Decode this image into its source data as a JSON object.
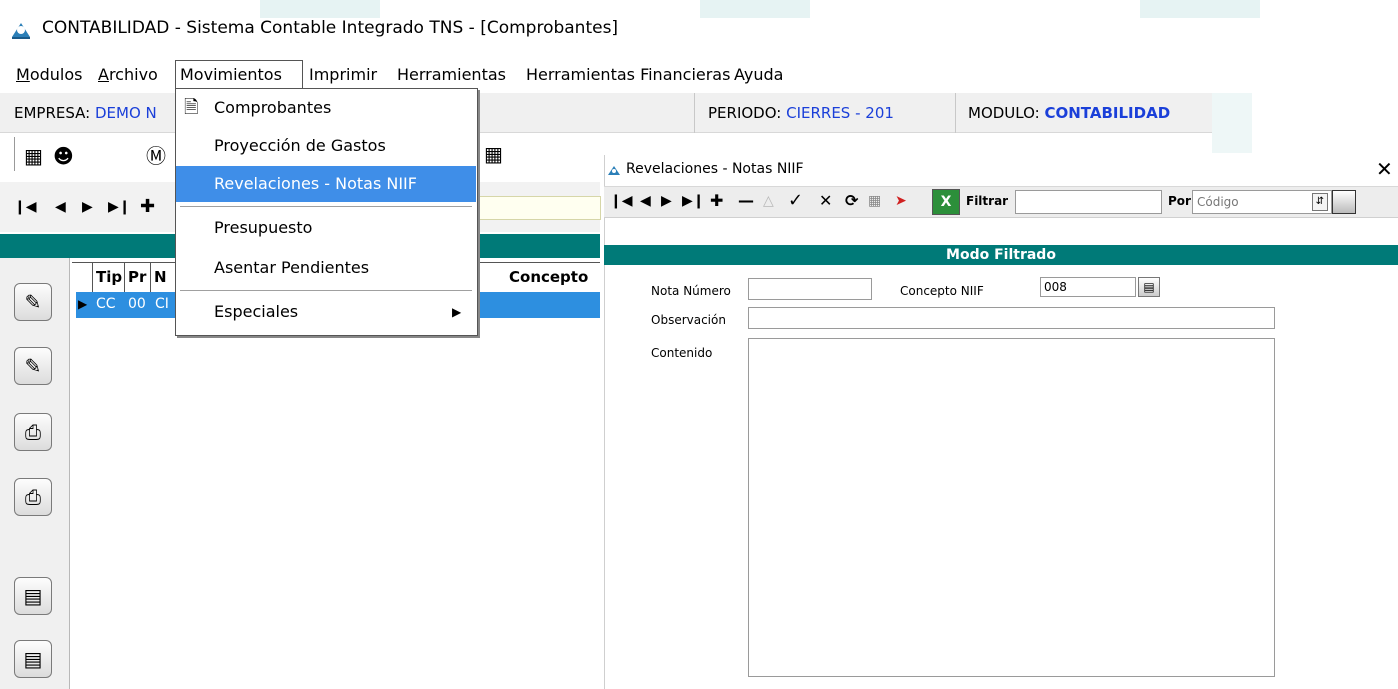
{
  "app": {
    "title": "CONTABILIDAD - Sistema Contable Integrado TNS - [Comprobantes]"
  },
  "menubar": {
    "items": [
      {
        "label": "Modulos"
      },
      {
        "label": "Archivo"
      },
      {
        "label": "Movimientos"
      },
      {
        "label": "Imprimir"
      },
      {
        "label": "Herramientas"
      },
      {
        "label": "Herramientas Financieras"
      },
      {
        "label": "Ayuda"
      }
    ]
  },
  "status": {
    "empresa_label": "EMPRESA:",
    "empresa_value": "DEMO N",
    "periodo_label": "PERIODO:",
    "periodo_value": "CIERRES - 201",
    "modulo_label": "MODULO:",
    "modulo_value": "CONTABILIDAD"
  },
  "dropdown": {
    "items": [
      {
        "label": "Comprobantes",
        "icon": "document-icon"
      },
      {
        "label": "Proyección de Gastos"
      },
      {
        "label": "Revelaciones - Notas NIIF",
        "highlighted": true
      },
      {
        "label": "Presupuesto"
      },
      {
        "label": "Asentar Pendientes"
      },
      {
        "label": "Especiales",
        "submenu": true
      }
    ]
  },
  "grid": {
    "headers": [
      "Tip",
      "Pr",
      "N",
      "Concepto"
    ],
    "rows": [
      {
        "tip": "CC",
        "pr": "00",
        "n": "CI"
      }
    ]
  },
  "dialog": {
    "title": "Revelaciones - Notas NIIF",
    "filtrar_label": "Filtrar",
    "filtrar_value": "",
    "por_label": "Por",
    "por_value": "Código",
    "excel_glyph": "X",
    "mode": "Modo Filtrado",
    "fields": {
      "nota_numero_label": "Nota Número",
      "nota_numero_value": "",
      "concepto_niif_label": "Concepto NIIF",
      "concepto_niif_value": "008",
      "observacion_label": "Observación",
      "observacion_value": "",
      "contenido_label": "Contenido",
      "contenido_value": ""
    }
  },
  "colors": {
    "teal": "#007a78",
    "highlight": "#3f8ee8",
    "status_blue": "#1a3fd9"
  }
}
